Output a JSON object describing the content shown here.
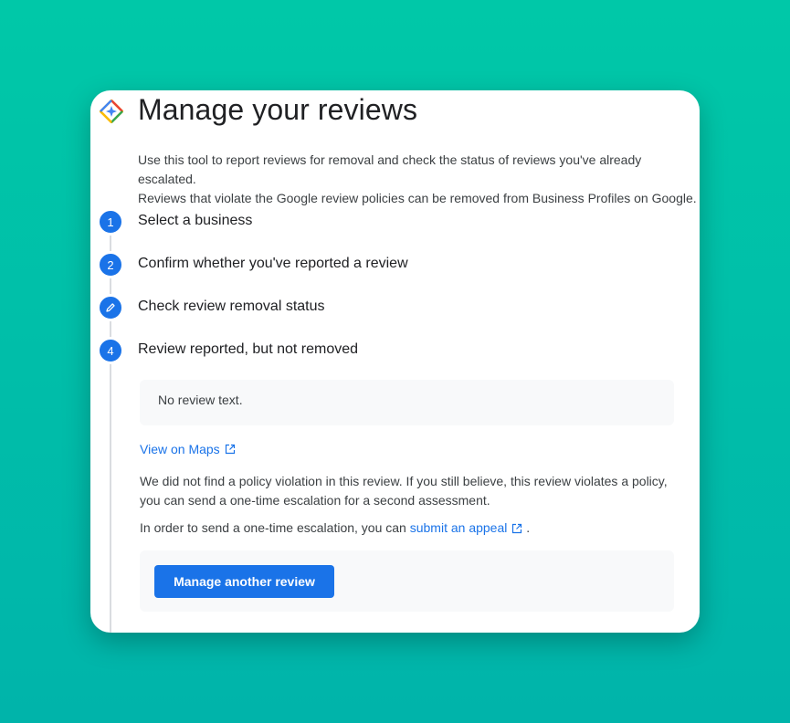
{
  "page": {
    "title": "Manage your reviews",
    "intro_line1": "Use this tool to report reviews for removal and check the status of reviews you've already escalated.",
    "intro_line2": "Reviews that violate the Google review policies can be removed from Business Profiles on Google."
  },
  "steps": [
    {
      "marker": "1",
      "label": "Select a business"
    },
    {
      "marker": "2",
      "label": "Confirm whether you've reported a review"
    },
    {
      "marker": "pencil-icon",
      "label": "Check review removal status"
    },
    {
      "marker": "4",
      "label": "Review reported, but not removed"
    }
  ],
  "result": {
    "review_text": "No review text.",
    "maps_link": "View on Maps",
    "no_violation_text": "We did not find a policy violation in this review. If you still believe, this review violates a policy, you can send a one-time escalation for a second assessment.",
    "escalation_prefix": "In order to send a one-time escalation, you can",
    "appeal_link": "submit an appeal",
    "escalation_suffix": ".",
    "manage_button": "Manage another review"
  },
  "colors": {
    "accent": "#1a73e8",
    "background_top": "#00c8a8",
    "background_bottom": "#00b4aa"
  }
}
